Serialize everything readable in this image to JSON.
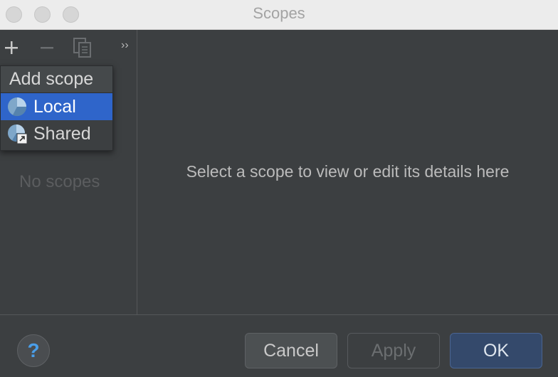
{
  "window": {
    "title": "Scopes"
  },
  "left_pane": {
    "empty_text": "No scopes"
  },
  "main": {
    "placeholder": "Select a scope to view or edit its details here"
  },
  "popup": {
    "header": "Add scope",
    "items": [
      {
        "label": "Local",
        "icon": "local-scope-icon",
        "selected": true
      },
      {
        "label": "Shared",
        "icon": "shared-scope-icon",
        "selected": false
      }
    ]
  },
  "buttons": {
    "cancel": "Cancel",
    "apply": "Apply",
    "ok": "OK",
    "help": "?"
  },
  "colors": {
    "background": "#3c3f41",
    "selection": "#2f65ca",
    "ok_button": "#34496b",
    "help_icon": "#4a9ee8"
  }
}
